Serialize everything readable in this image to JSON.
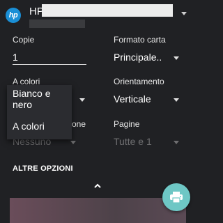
{
  "header": {
    "logo_text": "hp",
    "printer_name": "HP"
  },
  "fields": {
    "copies": {
      "label": "Copie",
      "value": "1"
    },
    "paper_size": {
      "label": "Formato carta",
      "value": "Principale.."
    },
    "color": {
      "label": "A colori"
    },
    "orientation": {
      "label": "Orientamento",
      "value": "Verticale"
    },
    "duplex": {
      "label_partial": "one",
      "value": "Nessuno"
    },
    "pages": {
      "label": "Pagine",
      "value": "Tutte e 1"
    }
  },
  "dropdown": {
    "options": [
      "Bianco e nero",
      "A colori"
    ]
  },
  "more_options_label": "ALTRE OPZIONI",
  "colors": {
    "background": "#202124",
    "fab": "#6ec7c5",
    "logo": "#1a8fd6",
    "muted_text": "#6e6e70"
  },
  "icons": {
    "fab": "printer-icon",
    "collapse": "chevron-up-icon",
    "dropdown": "caret-down-icon"
  }
}
